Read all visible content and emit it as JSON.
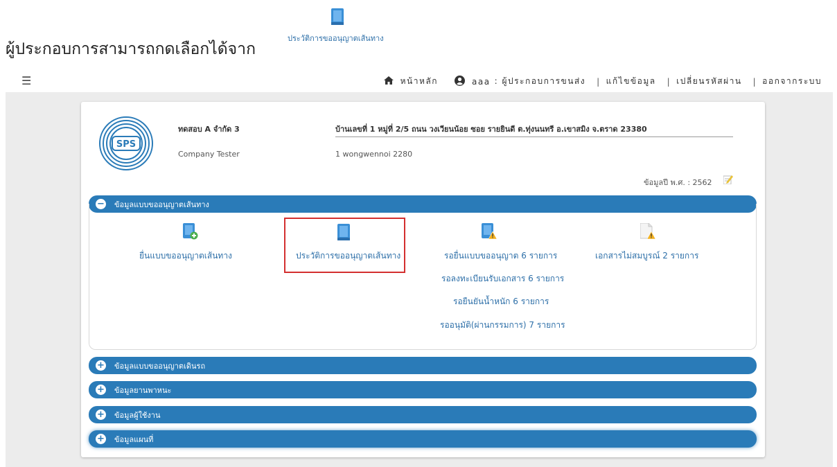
{
  "caption": {
    "text": "ผู้ประกอบการสามารถกดเลือกได้จาก",
    "link_label": "ประวัติการขออนุญาตเส้นทาง"
  },
  "navbar": {
    "home_label": "หน้าหลัก",
    "user_label": "aaa",
    "role_label": ": ผู้ประกอบการขนส่ง",
    "edit_label": "แก้ไขข้อมูล",
    "password_label": "เปลี่ยนรหัสผ่าน",
    "logout_label": "ออกจากระบบ",
    "separator": "|",
    "menu_icon": "☰"
  },
  "company": {
    "logo_text": "SPS",
    "name": "ทดสอบ A จำกัด 3",
    "name_en": "Company Tester",
    "address": "บ้านเลขที่ 1 หมู่ที่ 2/5 ถนน วงเวียนน้อย ซอย รายยินดี ต.ทุ่งนนทรี อ.เขาสมิง จ.ตราด 23380",
    "address2": "1 wongwennoi 2280",
    "year_label": "ข้อมูลปี พ.ศ. : 2562"
  },
  "sections": [
    {
      "label": "ข้อมูลแบบขออนุญาตเส้นทาง",
      "sign": "−"
    },
    {
      "label": "ข้อมูลแบบขออนุญาตเดินรถ",
      "sign": "+"
    },
    {
      "label": "ข้อมูลยานพาหนะ",
      "sign": "+"
    },
    {
      "label": "ข้อมูลผู้ใช้งาน",
      "sign": "+"
    },
    {
      "label": "ข้อมูลแผนที่",
      "sign": "+"
    }
  ],
  "menu": {
    "submit": "ยื่นแบบขออนุญาตเส้นทาง",
    "history": "ประวัติการขออนุญาตเส้นทาง",
    "pending_submit": "รอยื่นแบบขออนุญาต 6 รายการ",
    "pending_register": "รอลงทะเบียนรับเอกสาร 6 รายการ",
    "pending_weight": "รอยืนยันน้ำหนัก 6 รายการ",
    "pending_approve": "รออนุมัติ(ผ่านกรรมการ) 7 รายการ",
    "incomplete_docs": "เอกสารไม่สมบูรณ์ 2 รายการ"
  },
  "colors": {
    "accent": "#2a7bb8",
    "link": "#2d6fa8",
    "highlight": "#d32f2f"
  }
}
